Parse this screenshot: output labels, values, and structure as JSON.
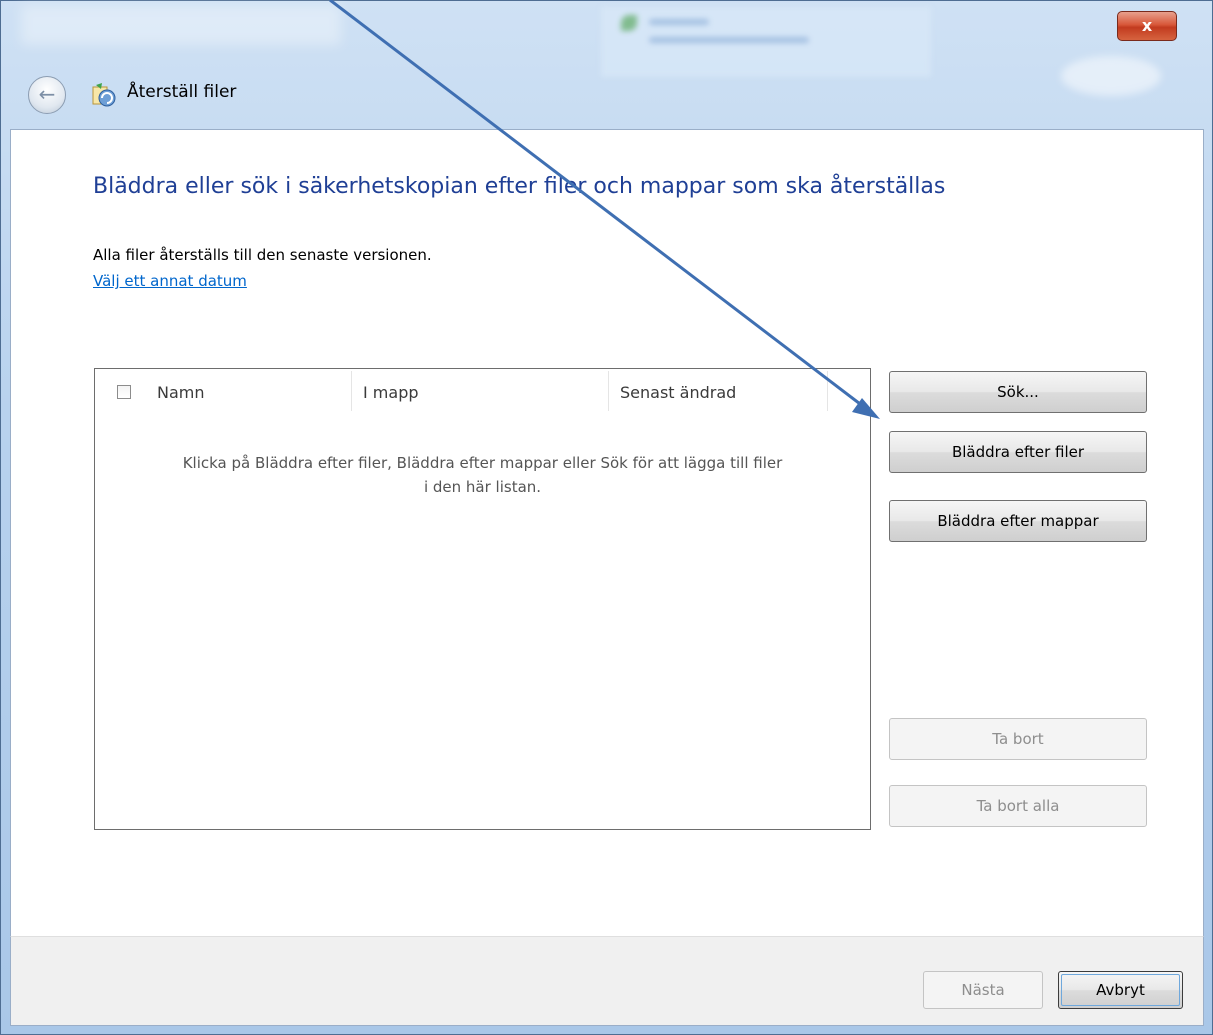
{
  "window": {
    "title": "Återställ filer",
    "close_symbol": "x",
    "back_symbol": "←"
  },
  "content": {
    "heading": "Bläddra eller sök i säkerhetskopian efter filer och mappar som ska återställas",
    "info": "Alla filer återställs till den senaste versionen.",
    "link": "Välj ett annat datum"
  },
  "list": {
    "columns": [
      "Namn",
      "I mapp",
      "Senast ändrad"
    ],
    "empty_line1": "Klicka på Bläddra efter filer, Bläddra efter mappar eller Sök för att lägga till filer",
    "empty_line2": "i den här listan."
  },
  "side_buttons": {
    "search": "Sök...",
    "browse_files": "Bläddra efter filer",
    "browse_folders": "Bläddra efter mappar",
    "remove": "Ta bort",
    "remove_all": "Ta bort alla"
  },
  "footer": {
    "next": "Nästa",
    "cancel": "Avbryt"
  },
  "colors": {
    "heading": "#1f3f95",
    "link": "#0066cc",
    "annotation_arrow": "#3f6fb2"
  },
  "icons": {
    "back": "back-arrow-icon",
    "app": "restore-files-icon",
    "close": "close-icon"
  }
}
